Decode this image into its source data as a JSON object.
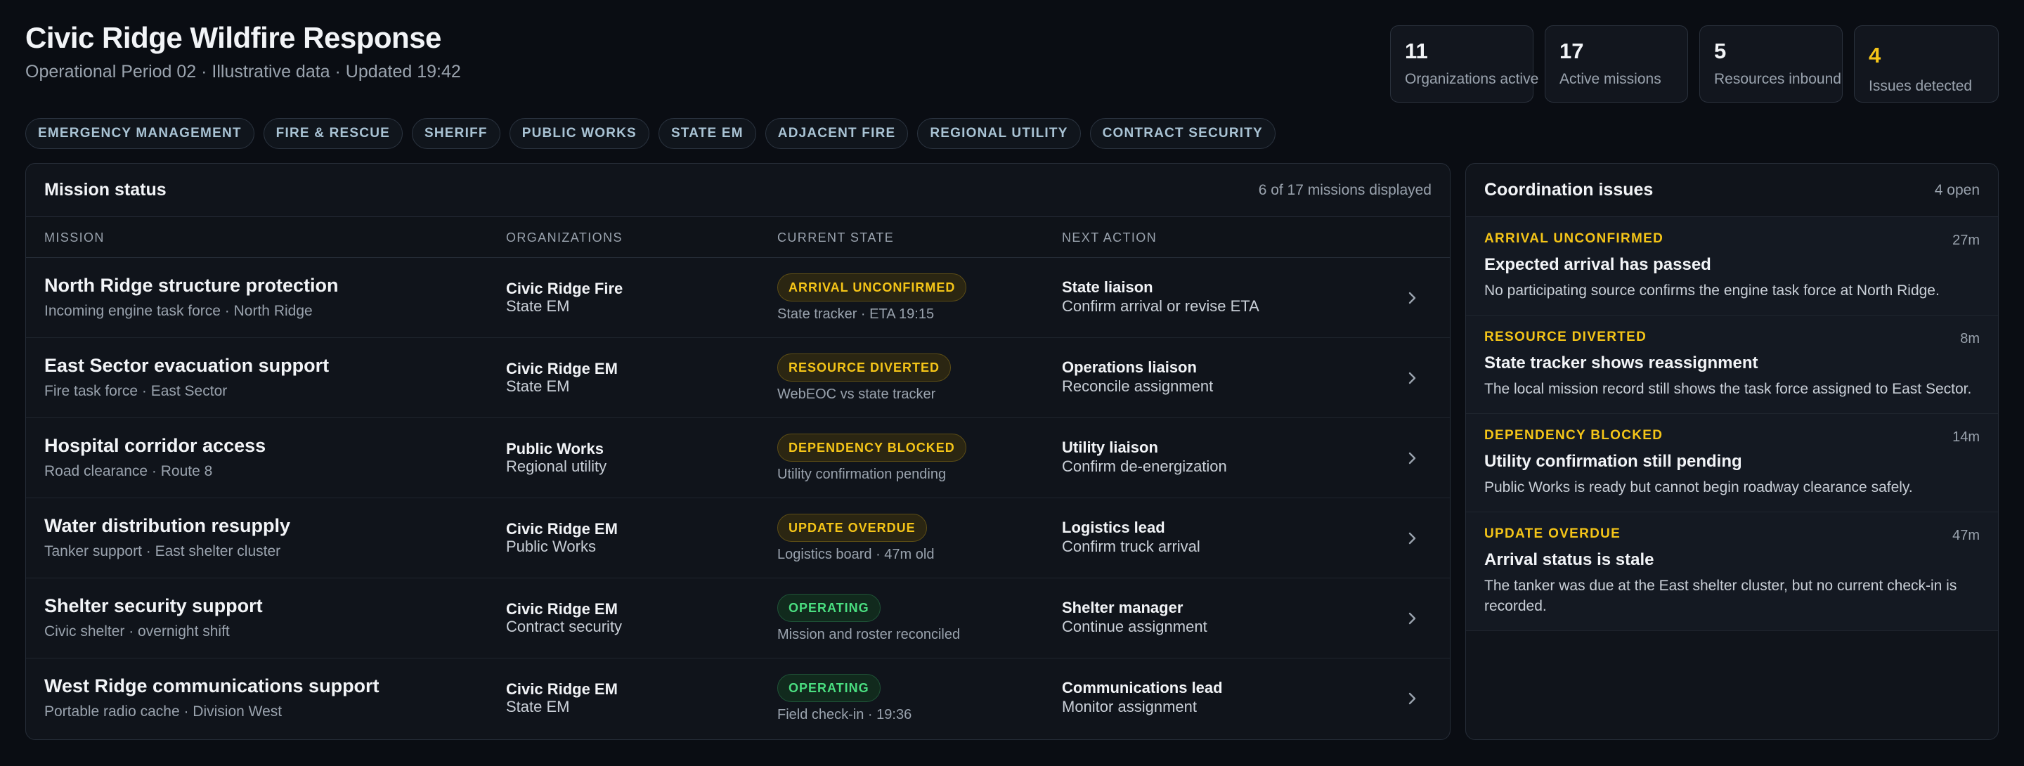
{
  "header": {
    "title": "Civic Ridge Wildfire Response",
    "subtitle": "Operational Period 02 · Illustrative data · Updated 19:42"
  },
  "stats": [
    {
      "value": "11",
      "label": "Organizations active"
    },
    {
      "value": "17",
      "label": "Active missions"
    },
    {
      "value": "5",
      "label": "Resources inbound"
    },
    {
      "value": "4",
      "label": "Issues detected"
    }
  ],
  "filters": [
    "EMERGENCY MANAGEMENT",
    "FIRE & RESCUE",
    "SHERIFF",
    "PUBLIC WORKS",
    "STATE EM",
    "ADJACENT FIRE",
    "REGIONAL UTILITY",
    "CONTRACT SECURITY"
  ],
  "missions_panel": {
    "title": "Mission status",
    "meta": "6 of 17 missions displayed",
    "columns": [
      "MISSION",
      "ORGANIZATIONS",
      "CURRENT STATE",
      "NEXT ACTION"
    ],
    "rows": [
      {
        "title": "North Ridge structure protection",
        "sub": "Incoming engine task force · North Ridge",
        "org1": "Civic Ridge Fire",
        "org2": "State EM",
        "state": "ARRIVAL UNCONFIRMED",
        "state_sub": "State tracker · ETA 19:15",
        "action": "State liaison",
        "action_sub": "Confirm arrival or revise ETA"
      },
      {
        "title": "East Sector evacuation support",
        "sub": "Fire task force · East Sector",
        "org1": "Civic Ridge EM",
        "org2": "State EM",
        "state": "RESOURCE DIVERTED",
        "state_sub": "WebEOC vs state tracker",
        "action": "Operations liaison",
        "action_sub": "Reconcile assignment"
      },
      {
        "title": "Hospital corridor access",
        "sub": "Road clearance · Route 8",
        "org1": "Public Works",
        "org2": "Regional utility",
        "state": "DEPENDENCY BLOCKED",
        "state_sub": "Utility confirmation pending",
        "action": "Utility liaison",
        "action_sub": "Confirm de-energization"
      },
      {
        "title": "Water distribution resupply",
        "sub": "Tanker support · East shelter cluster",
        "org1": "Civic Ridge EM",
        "org2": "Public Works",
        "state": "UPDATE OVERDUE",
        "state_sub": "Logistics board · 47m old",
        "action": "Logistics lead",
        "action_sub": "Confirm truck arrival"
      },
      {
        "title": "Shelter security support",
        "sub": "Civic shelter · overnight shift",
        "org1": "Civic Ridge EM",
        "org2": "Contract security",
        "state": "OPERATING",
        "state_sub": "Mission and roster reconciled",
        "action": "Shelter manager",
        "action_sub": "Continue assignment"
      },
      {
        "title": "West Ridge communications support",
        "sub": "Portable radio cache · Division West",
        "org1": "Civic Ridge EM",
        "org2": "State EM",
        "state": "OPERATING",
        "state_sub": "Field check-in · 19:36",
        "action": "Communications lead",
        "action_sub": "Monitor assignment"
      }
    ]
  },
  "issues_panel": {
    "title": "Coordination issues",
    "meta": "4 open",
    "items": [
      {
        "tag": "ARRIVAL UNCONFIRMED",
        "ago": "27m",
        "title": "Expected arrival has passed",
        "desc": "No participating source confirms the engine task force at North Ridge."
      },
      {
        "tag": "RESOURCE DIVERTED",
        "ago": "8m",
        "title": "State tracker shows reassignment",
        "desc": "The local mission record still shows the task force assigned to East Sector."
      },
      {
        "tag": "DEPENDENCY BLOCKED",
        "ago": "14m",
        "title": "Utility confirmation still pending",
        "desc": "Public Works is ready but cannot begin roadway clearance safely."
      },
      {
        "tag": "UPDATE OVERDUE",
        "ago": "47m",
        "title": "Arrival status is stale",
        "desc": "The tanker was due at the East shelter cluster, but no current check-in is recorded."
      }
    ]
  },
  "colors": {
    "background": "#0a0d13",
    "panel": "#10141b",
    "warning": "#f5c518",
    "ok": "#4ade80",
    "chip_text": "#a9c3d4"
  },
  "icons": {
    "row_action": "chevron-right-icon"
  }
}
